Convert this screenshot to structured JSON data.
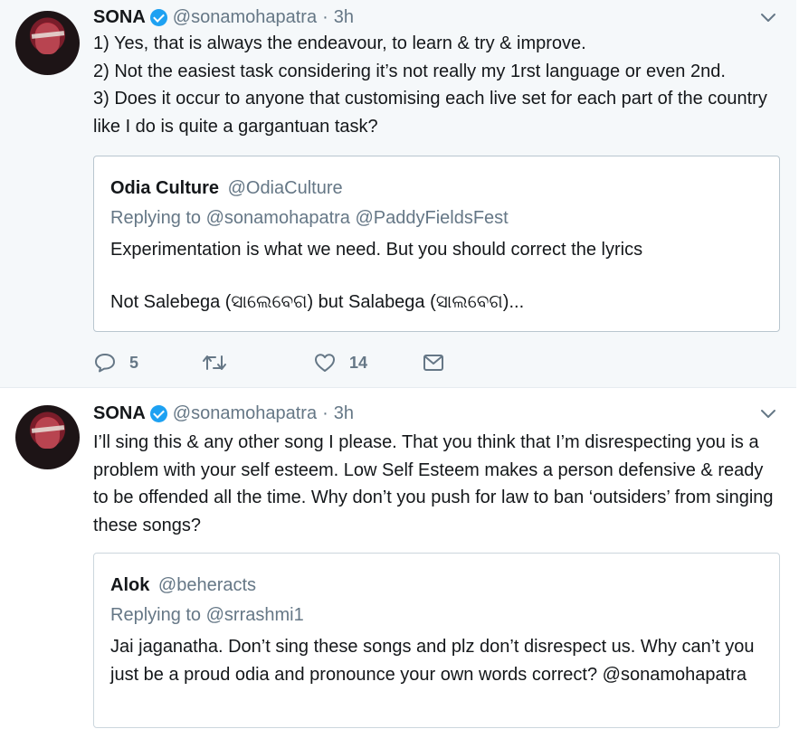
{
  "tweets": [
    {
      "author": "SONA",
      "handle": "@sonamohapatra",
      "separator": "·",
      "time": "3h",
      "lines": [
        "1) Yes, that is always the endeavour, to learn & try & improve.",
        "2) Not the easiest task considering it’s not really my 1rst language or even 2nd.",
        "3) Does it occur to anyone that customising each live set for each part of the country like I do is quite a gargantuan task?"
      ],
      "quote": {
        "name": "Odia Culture",
        "handle": "@OdiaCulture",
        "replying_prefix": "Replying to",
        "replying_to": "@sonamohapatra @PaddyFieldsFest",
        "line1": "Experimentation is what we need. But you should correct the lyrics",
        "line2": "Not Salebega (ସାଲେବେଗ) but Salabega (ସାଲବେଗ)..."
      },
      "actions": {
        "replies": "5",
        "retweets": "",
        "likes": "14"
      }
    },
    {
      "author": "SONA",
      "handle": "@sonamohapatra",
      "separator": "·",
      "time": "3h",
      "text": "I’ll sing this & any other song I please. That you think that I’m disrespecting you is a problem with your self esteem. Low Self Esteem makes a person defensive & ready to be offended all the time. Why don’t you push for law to ban ‘outsiders’ from singing these songs?",
      "quote": {
        "name": "Alok",
        "handle": "@beheracts",
        "replying_prefix": "Replying to",
        "replying_to": "@srrashmi1",
        "text": "Jai jaganatha. Don’t sing these songs and plz don’t disrespect us. Why can’t you just be a proud odia and pronounce your own words correct? @sonamohapatra"
      }
    }
  ],
  "colors": {
    "verified": "#1da1f2",
    "secondary_text": "#657786",
    "highlight_bg": "#f5f8fa"
  },
  "icons": [
    "chevron-down-icon",
    "verified-badge-icon",
    "reply-icon",
    "retweet-icon",
    "like-icon",
    "direct-message-icon"
  ]
}
